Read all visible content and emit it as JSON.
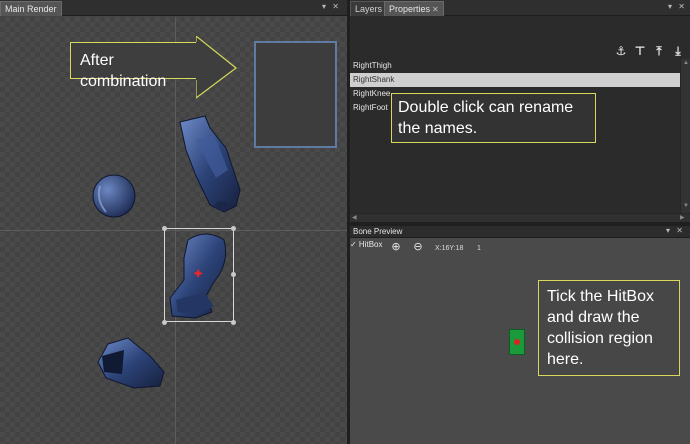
{
  "main_render": {
    "tab_label": "Main Render",
    "window_controls": "▾ ✕"
  },
  "annotations": {
    "combination": "After combination",
    "rename": "Double click can rename the names.",
    "hitbox": "Tick the HitBox and draw the collision region here."
  },
  "properties_panel": {
    "tabs": [
      {
        "label": "Layers",
        "active": false
      },
      {
        "label": "Properties",
        "active": true,
        "close": "✕"
      }
    ],
    "window_controls": "▾ ✕",
    "toolbar_icons": [
      "anchor-icon",
      "align-top-icon",
      "move-top-icon",
      "move-bottom-icon"
    ],
    "bones": [
      {
        "name": "RightThigh",
        "selected": false
      },
      {
        "name": "RightShank",
        "selected": true
      },
      {
        "name": "RightKnee",
        "selected": false
      },
      {
        "name": "RightFoot",
        "selected": false
      }
    ]
  },
  "bone_preview": {
    "title": "Bone Preview",
    "window_controls": "▾ ✕",
    "hitbox_label": "✓ HitBox",
    "hitbox_checked": true,
    "coordinates": "X:16Y:18",
    "zoom_value": "1"
  },
  "colors": {
    "callout_border": "#d8d95a",
    "selection_highlight": "#cfcfcf",
    "preview_border": "#5f7aa3",
    "hitbox_fill": "#1a9a3a",
    "pivot_marker": "#ff2222"
  }
}
